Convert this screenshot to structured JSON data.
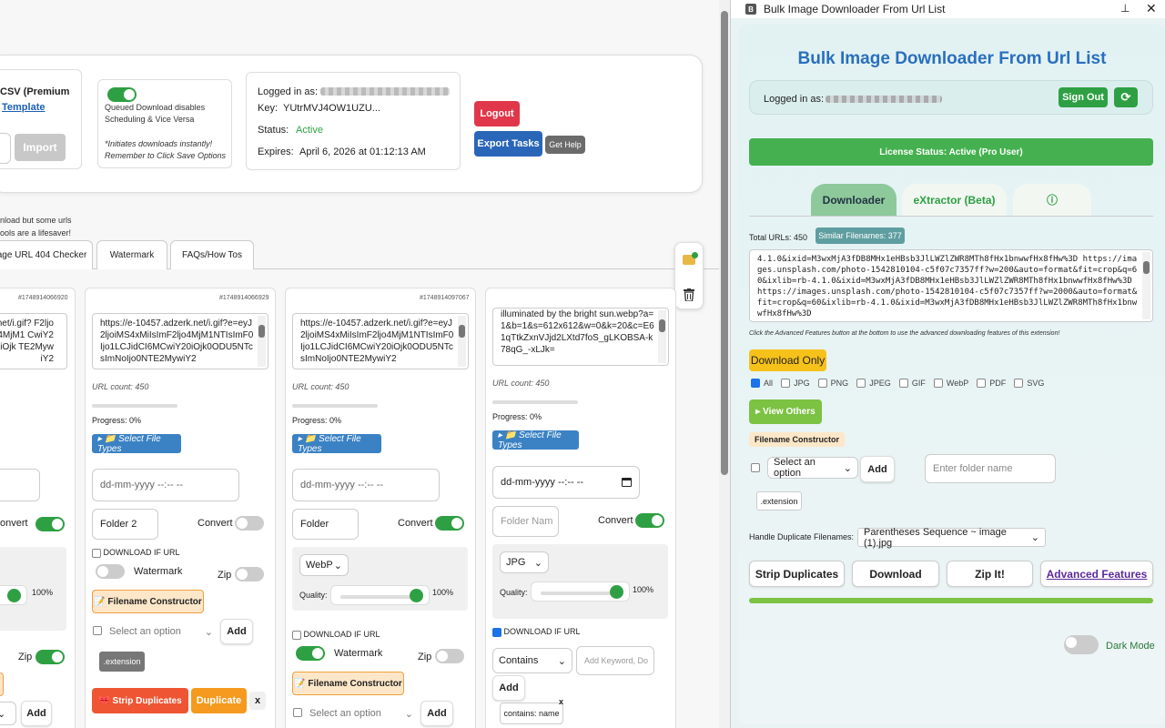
{
  "left": {
    "csv_title": "CSV (Premium",
    "csv_template": "Template",
    "import_label": "Import",
    "queued_text": "Queued Download disables Scheduling & Vice Versa",
    "queued_note": "*Initiates downloads instantly! Remember to Click Save Options",
    "logged_in_label": "Logged in as:",
    "key_label": "Key:",
    "key_value": "YUtrMVJ4OW1UZU...",
    "status_label": "Status:",
    "status_value": "Active",
    "expires_label": "Expires:",
    "expires_value": "April 6, 2026 at 01:12:13 AM",
    "logout": "Logout",
    "export": "Export Tasks",
    "help": "Get Help",
    "note_line1": "nload but some urls",
    "note_line2": "ools are a lifesaver!",
    "tabs": [
      "age URL 404 Checker",
      "Watermark",
      "FAQs/How Tos"
    ],
    "cols": [
      {
        "id": "#1748914066920",
        "url": "net/i.gif? F2ljo4MjM1 CwiY20iOjk TE2MywiY2"
      },
      {
        "id": "#1748914066929",
        "url": "https://e-10457.adzerk.net/i.gif?e=eyJ2ljoiMS4xMiIsImF2ljo4MjM1NTIsImF0Ijo1LCJidCI6MCwiY20iOjk0ODU5NTcsImNoIjo0NTE2MywiY2"
      },
      {
        "id": "#1748914097067",
        "url": "https://e-10457.adzerk.net/i.gif?e=eyJ2ljoiMS4xMiIsImF2ljo4MjM1NTIsImF0Ijo1LCJidCI6MCwiY20iOjk0ODU5NTcsImNoIjo0NTE2MywiY2"
      },
      {
        "id": "",
        "url": "illuminated by the bright sun.webp?a=1&b=1&s=612x612&w=0&k=20&c=E61qTtkZxnVJjd2LXtd7foS_gLKOBSA-k78qG_-xLJk="
      }
    ],
    "url_count": "URL count: 450",
    "progress": "Progress: 0%",
    "select_types": "▸ 📁 Select File Types",
    "date_placeholder": "dd-mm-yyyy --:-- --",
    "folder2": "Folder 2",
    "folder": "Folder",
    "folder_placeholder": "Folder Nam",
    "convert": "Convert",
    "download_if_url": "DOWNLOAD IF URL",
    "watermark": "Watermark",
    "zip": "Zip",
    "filename_constructor": "📝 Filename Constructor",
    "select_option": "Select an option",
    "add": "Add",
    "extension": ".extension",
    "strip_duplicates": "🎀 Strip Duplicates",
    "duplicate": "Duplicate",
    "close_x": "x",
    "webp": "WebP",
    "jpg": "JPG",
    "quality": "Quality:",
    "pct": "100%",
    "contains": "Contains",
    "keyword_placeholder": "Add Keyword, Do",
    "contains_tag": "contains: name",
    "convert_left": "onvert"
  },
  "panel": {
    "window_title": "Bulk Image Downloader From Url List",
    "heading": "Bulk Image Downloader From Url List",
    "logged_in": "Logged in as:",
    "sign_out": "Sign Out",
    "license": "License Status: Active (Pro User)",
    "tabs": [
      "Downloader",
      "eXtractor (Beta)",
      "ⓘ"
    ],
    "total_urls": "Total URLs: 450",
    "similar": "Similar Filenames: 377",
    "url_text": "4.1.0&ixid=M3wxMjA3fDB8MHx1eHBsb3JlLWZlZWR8MTh8fHx1bnwwfHx8fHw%3D https://images.unsplash.com/photo-1542810104-c5f07c7357ff?w=200&auto=format&fit=crop&q=60&ixlib=rb-4.1.0&ixid=M3wxMjA3fDB8MHx1eHBsb3JlLWZlZWR8MTh8fHx1bnwwfHx8fHw%3D https://images.unsplash.com/photo-1542810104-c5f07c7357ff?w=2000&auto=format&fit=crop&q=60&ixlib=rb-4.1.0&ixid=M3wxMjA3fDB8MHx1eHBsb3JlLWZlZWR8MTh8fHx1bnwwfHx8fHw%3D",
    "advanced_hint": "Click the Advanced Features button at the bottom to use the advanced downloading features of this extension!",
    "download_only": "Download Only",
    "types": [
      "All",
      "JPG",
      "PNG",
      "JPEG",
      "GIF",
      "WebP",
      "PDF",
      "SVG"
    ],
    "view_others": "▸ View Others",
    "filename_constructor": "Filename Constructor",
    "select_option": "Select an option",
    "add": "Add",
    "folder_placeholder": "Enter folder name",
    "extension": ".extension",
    "dup_label": "Handle Duplicate Filenames:",
    "dup_value": "Parentheses Sequence ~ image (1).jpg",
    "strip": "Strip Duplicates",
    "download": "Download",
    "zip": "Zip It!",
    "advanced": "Advanced Features",
    "dark_mode": "Dark Mode",
    "colors": {
      "green": "#2ea043",
      "blue": "#2a6fbd",
      "yellow": "#f6c21a"
    }
  }
}
